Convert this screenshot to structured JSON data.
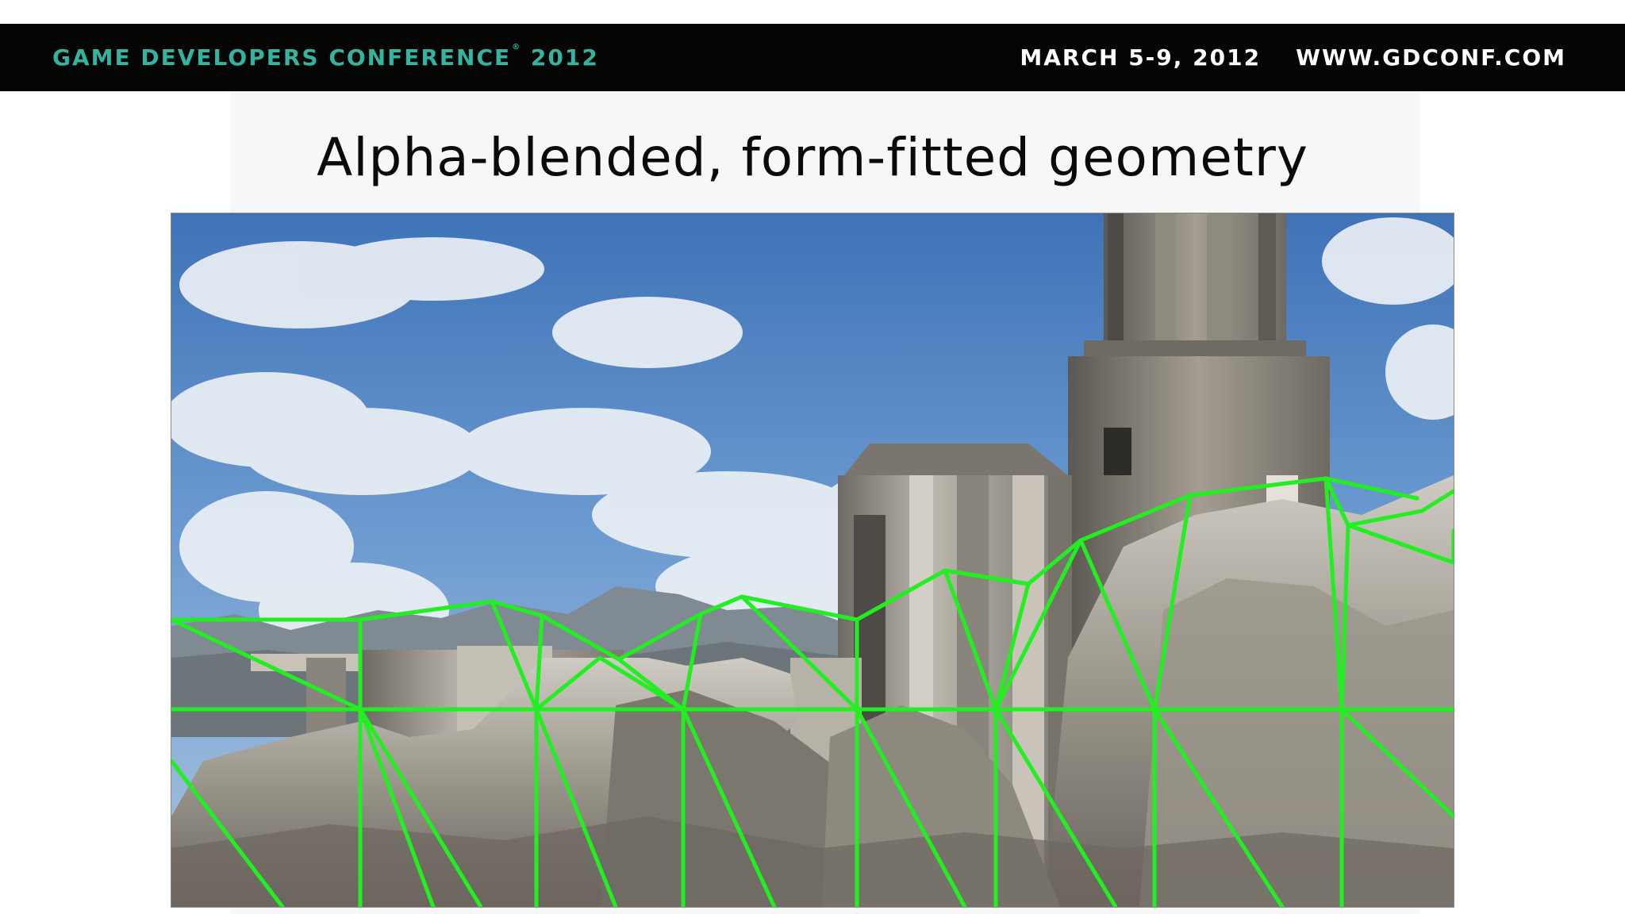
{
  "header": {
    "conference": "GAME DEVELOPERS CONFERENCE",
    "trademark": "®",
    "year": "2012",
    "dates": "MARCH 5-9, 2012",
    "website": "WWW.GDCONF.COM"
  },
  "slide": {
    "title": "Alpha-blended, form-fitted geometry"
  },
  "colors": {
    "banner_bg": "#050505",
    "banner_accent": "#34b3a0",
    "wireframe": "#22ee22"
  }
}
